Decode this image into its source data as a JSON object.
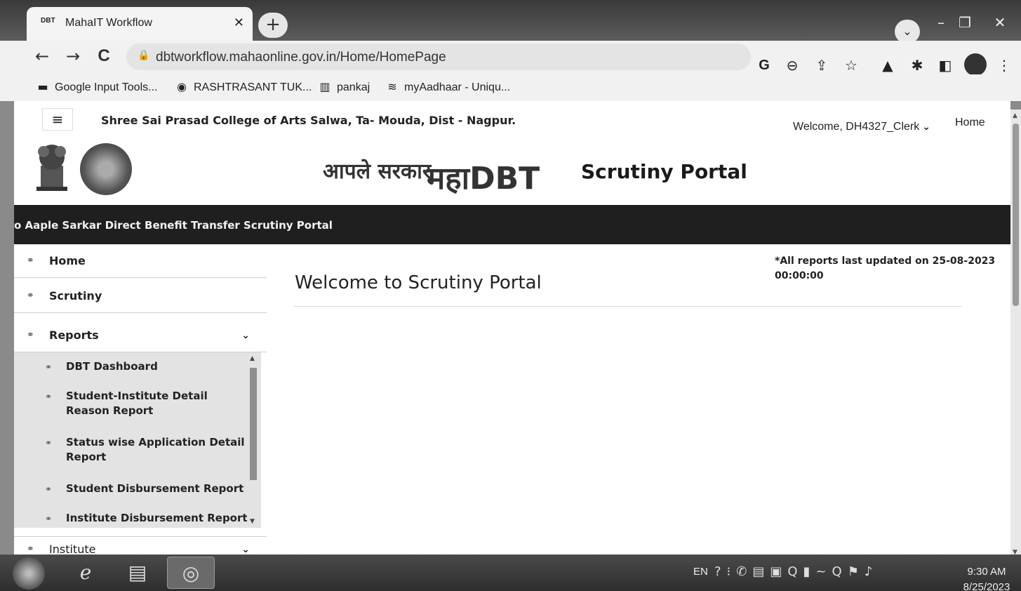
{
  "browser": {
    "tab": {
      "favicon": "DBT",
      "title": "MahaIT Workflow"
    },
    "new_tab_label": "+",
    "url": "dbtworkflow.mahaonline.gov.in/Home/HomePage",
    "nav": {
      "back": "←",
      "forward": "→",
      "reload": "C"
    },
    "bookmarks": [
      {
        "label": "Google Input Tools...",
        "icon": "google-input-tools-icon",
        "glyph": "▬"
      },
      {
        "label": "RASHTRASANT TUK...",
        "icon": "university-logo-icon",
        "glyph": "◉"
      },
      {
        "label": "pankaj",
        "icon": "bookmark-page-icon",
        "glyph": "▥"
      },
      {
        "label": "myAadhaar - Uniqu...",
        "icon": "aadhaar-icon",
        "glyph": "≋"
      }
    ]
  },
  "page": {
    "college_name": "Shree Sai Prasad College of Arts Salwa, Ta- Mouda, Dist - Nagpur.",
    "welcome_user": "Welcome, DH4327_Clerk",
    "home_link": "Home",
    "logo_aaple": "आपले सरकार",
    "logo_maha": "महाDBT",
    "portal_title": "Scrutiny Portal",
    "marquee": "o Aaple Sarkar Direct Benefit Transfer Scrutiny Portal",
    "main_title": "Welcome to Scrutiny Portal",
    "updated_note": "*All reports last updated on 25-08-2023 00:00:00"
  },
  "sidebar": {
    "items": [
      {
        "label": "Home"
      },
      {
        "label": "Scrutiny"
      },
      {
        "label": "Reports"
      },
      {
        "label": "Institute"
      }
    ],
    "reports_submenu": [
      "DBT Dashboard",
      "Student-Institute Detail Reason Report",
      "Status wise Application Detail Report",
      "Student Disbursement Report",
      "Institute Disbursement Report"
    ]
  },
  "taskbar": {
    "lang": "EN",
    "time": "9:30 AM",
    "date": "8/25/2023"
  }
}
